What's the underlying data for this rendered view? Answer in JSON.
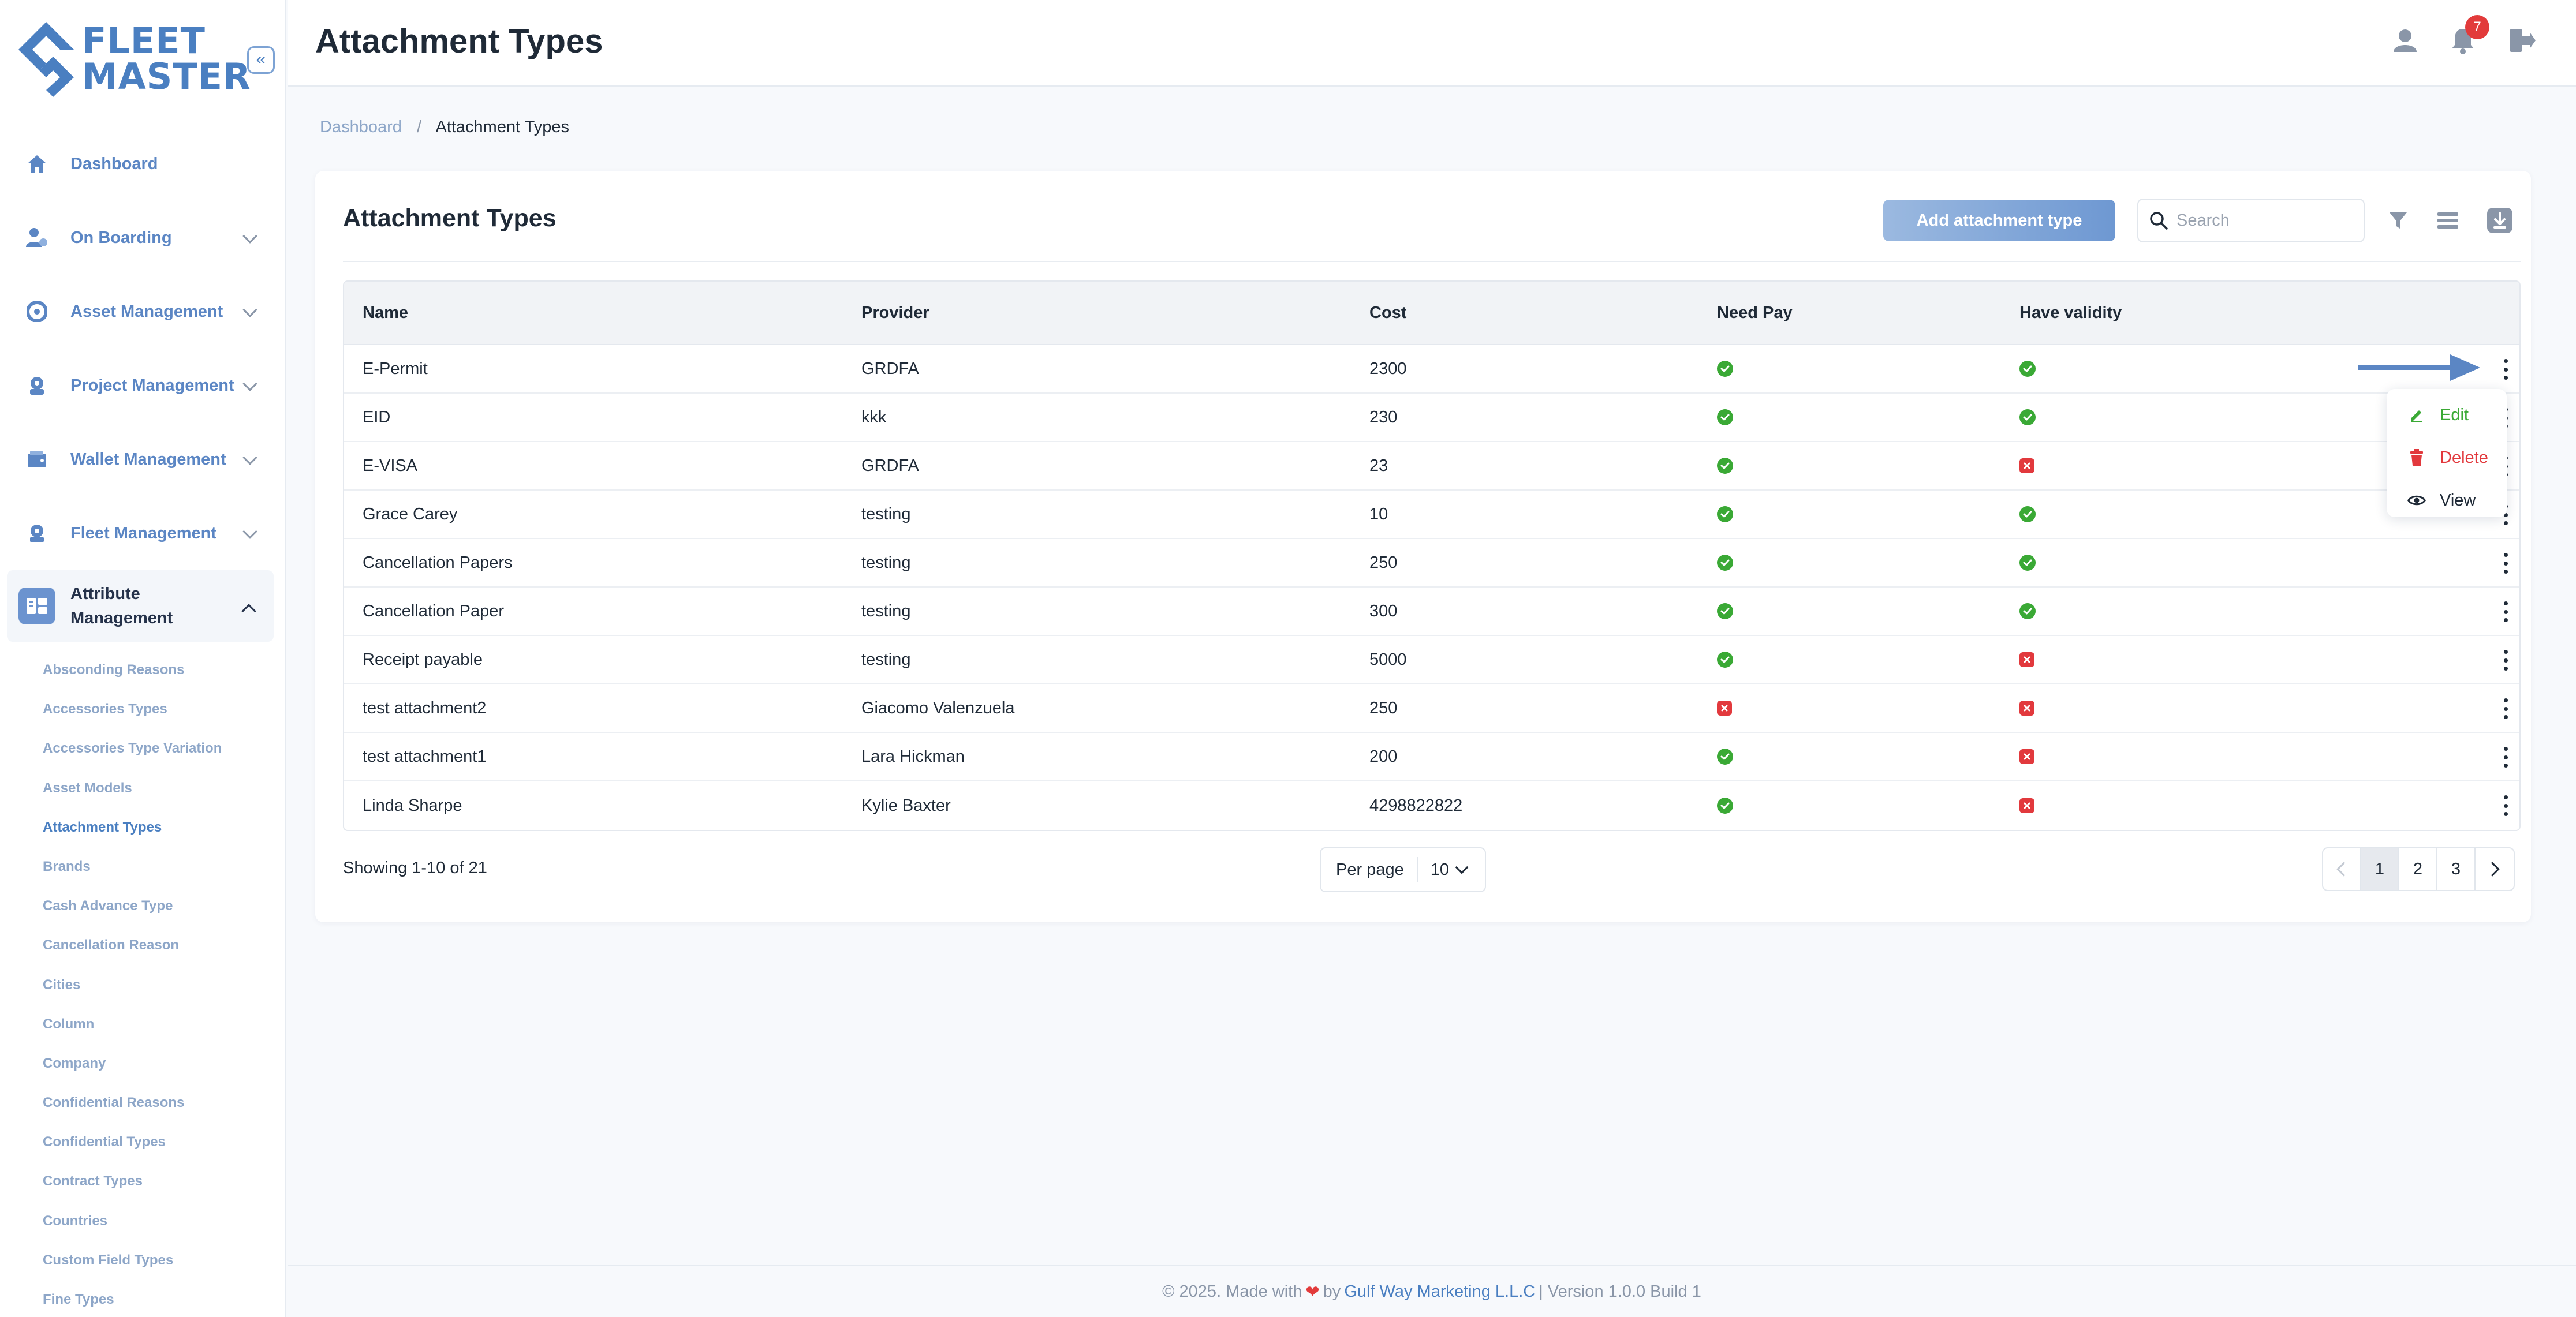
{
  "app": {
    "logo_line1": "FLEET",
    "logo_line2": "MASTER",
    "collapse_icon": "double-chevron-left-icon"
  },
  "sidebar": {
    "items": [
      {
        "label": "Dashboard",
        "icon": "home-icon"
      },
      {
        "label": "On Boarding",
        "icon": "user-onboard-icon"
      },
      {
        "label": "Asset Management",
        "icon": "asset-icon"
      },
      {
        "label": "Project Management",
        "icon": "project-icon"
      },
      {
        "label": "Wallet Management",
        "icon": "wallet-icon"
      },
      {
        "label": "Fleet Management",
        "icon": "fleet-icon"
      },
      {
        "label": "Attribute Management",
        "icon": "attribute-icon"
      }
    ],
    "sub_items": [
      "Absconding Reasons",
      "Accessories Types",
      "Accessories Type Variation",
      "Asset Models",
      "Attachment Types",
      "Brands",
      "Cash Advance Type",
      "Cancellation Reason",
      "Cities",
      "Column",
      "Company",
      "Confidential Reasons",
      "Confidential Types",
      "Contract Types",
      "Countries",
      "Custom Field Types",
      "Fine Types"
    ],
    "active_sub": "Attachment Types"
  },
  "header": {
    "title": "Attachment Types",
    "notification_count": "7",
    "icons": [
      "user-icon",
      "bell-icon",
      "logout-icon"
    ]
  },
  "breadcrumb": {
    "home": "Dashboard",
    "separator": "/",
    "current": "Attachment Types"
  },
  "card": {
    "title": "Attachment Types",
    "add_button": "Add attachment type",
    "search_placeholder": "Search"
  },
  "table": {
    "columns": [
      "Name",
      "Provider",
      "Cost",
      "Need Pay",
      "Have validity"
    ],
    "rows": [
      {
        "name": "E-Permit",
        "provider": "GRDFA",
        "cost": "2300",
        "need_pay": true,
        "have_validity": true
      },
      {
        "name": "EID",
        "provider": "kkk",
        "cost": "230",
        "need_pay": true,
        "have_validity": true
      },
      {
        "name": "E-VISA",
        "provider": "GRDFA",
        "cost": "23",
        "need_pay": true,
        "have_validity": false
      },
      {
        "name": "Grace Carey",
        "provider": "testing",
        "cost": "10",
        "need_pay": true,
        "have_validity": true
      },
      {
        "name": "Cancellation Papers",
        "provider": "testing",
        "cost": "250",
        "need_pay": true,
        "have_validity": true
      },
      {
        "name": "Cancellation Paper",
        "provider": "testing",
        "cost": "300",
        "need_pay": true,
        "have_validity": true
      },
      {
        "name": "Receipt payable",
        "provider": "testing",
        "cost": "5000",
        "need_pay": true,
        "have_validity": false
      },
      {
        "name": "test attachment2",
        "provider": "Giacomo Valenzuela",
        "cost": "250",
        "need_pay": false,
        "have_validity": false
      },
      {
        "name": "test attachment1",
        "provider": "Lara Hickman",
        "cost": "200",
        "need_pay": true,
        "have_validity": false
      },
      {
        "name": "Linda Sharpe",
        "provider": "Kylie Baxter",
        "cost": "4298822822",
        "need_pay": true,
        "have_validity": false
      }
    ]
  },
  "row_menu": {
    "edit": "Edit",
    "delete": "Delete",
    "view": "View",
    "colors": {
      "edit": "#3aa935",
      "delete": "#e2393d",
      "view": "#1f2a37"
    }
  },
  "pagination": {
    "showing": "Showing 1-10 of 21",
    "per_page_label": "Per page",
    "per_page_value": "10",
    "pages": [
      "1",
      "2",
      "3"
    ],
    "current_page": "1"
  },
  "footer": {
    "prefix": "© 2025. Made with",
    "by": "by",
    "company": "Gulf Way Marketing L.L.C",
    "suffix": "| Version 1.0.0 Build 1"
  },
  "colors": {
    "brand": "#4a7fc1",
    "ok": "#3aa935",
    "error": "#e2393d"
  }
}
